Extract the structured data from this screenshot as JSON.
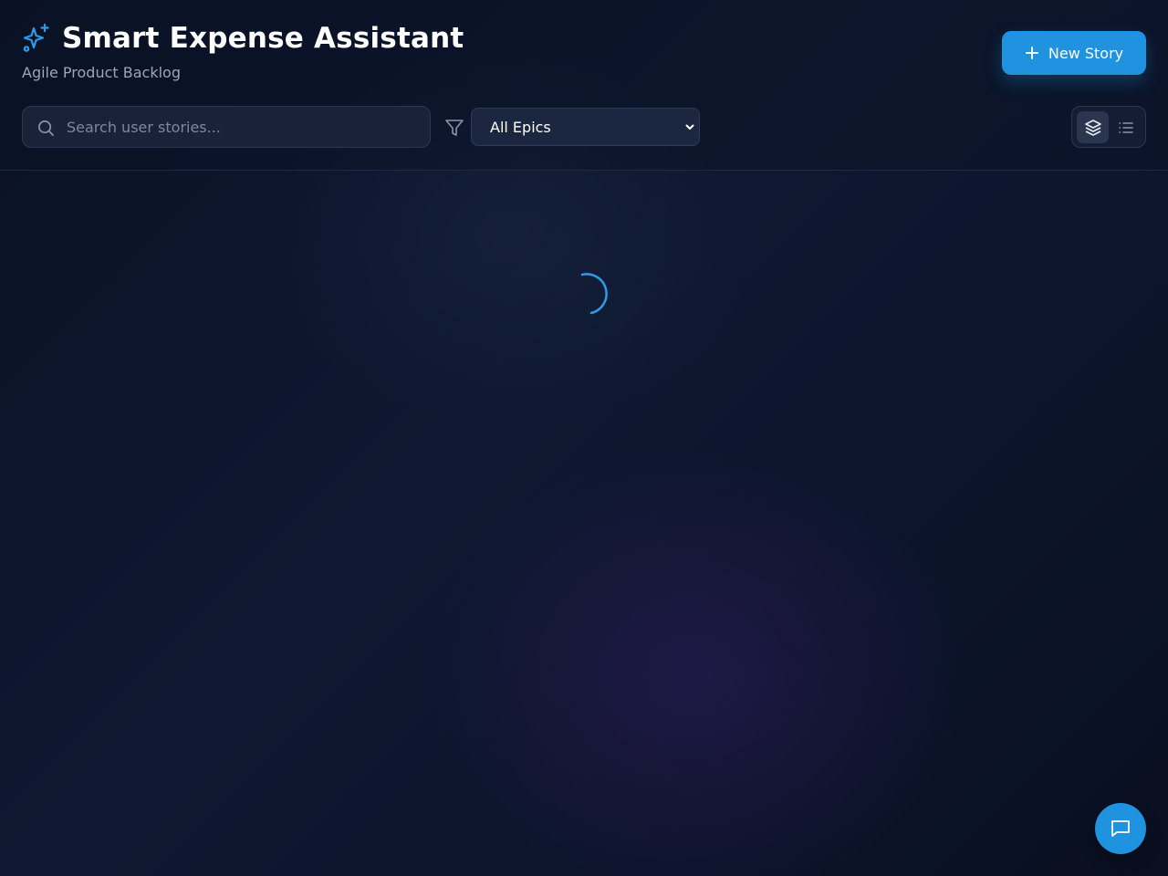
{
  "app": {
    "title": "Smart Expense Assistant",
    "subtitle": "Agile Product Backlog",
    "logo_icon": "sparkles-icon"
  },
  "toolbar": {
    "new_story_label": "New Story",
    "new_story_icon": "plus-icon"
  },
  "search": {
    "placeholder": "Search user stories...",
    "value": ""
  },
  "filter": {
    "icon": "filter-icon",
    "selected": "All Epics"
  },
  "view_toggle": {
    "options": [
      "board",
      "list"
    ],
    "active": "board"
  },
  "main": {
    "state": "loading"
  },
  "chat": {
    "icon": "message-square-icon"
  },
  "colors": {
    "accent": "#1f93e0",
    "background": "#0c1428",
    "surface": "#18233a"
  }
}
